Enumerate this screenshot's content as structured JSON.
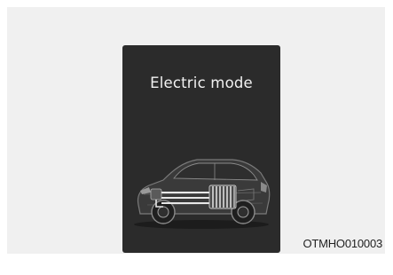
{
  "display": {
    "mode_label": "Electric mode"
  },
  "figure": {
    "code": "OTMHO010003"
  },
  "icons": {
    "vehicle": "car-power-flow-illustration"
  }
}
